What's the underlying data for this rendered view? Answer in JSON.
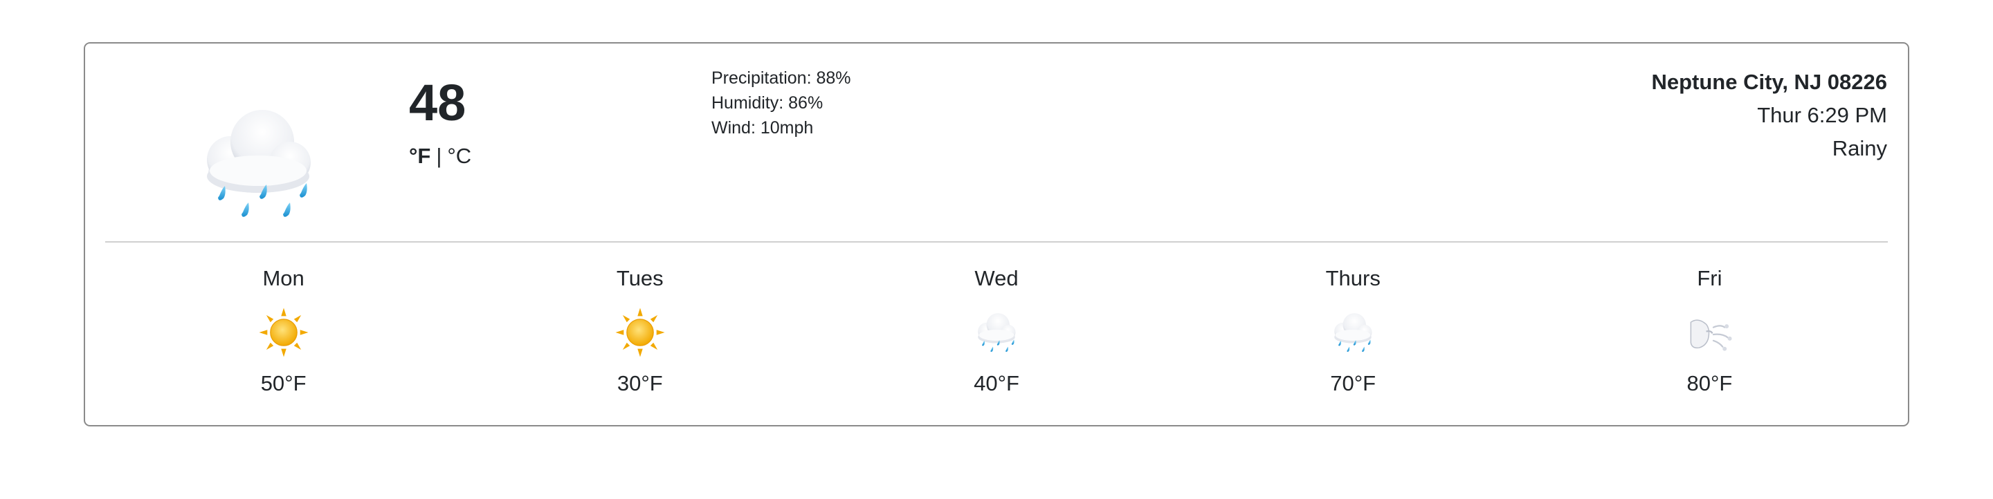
{
  "current": {
    "icon": "cloud-with-rain-icon",
    "temperature": "48",
    "unit_f": "°F",
    "unit_separator": "|",
    "unit_c": "°C",
    "precipitation": "Precipitation: 88%",
    "humidity": "Humidity: 86%",
    "wind": "Wind: 10mph"
  },
  "location": {
    "city": "Neptune City, NJ 08226",
    "datetime": "Thur 6:29 PM",
    "condition": "Rainy"
  },
  "forecast": [
    {
      "day": "Mon",
      "icon": "sun-icon",
      "temp": "50°F"
    },
    {
      "day": "Tues",
      "icon": "sun-icon",
      "temp": "30°F"
    },
    {
      "day": "Wed",
      "icon": "cloud-with-rain-icon",
      "temp": "40°F"
    },
    {
      "day": "Thurs",
      "icon": "cloud-with-rain-icon",
      "temp": "70°F"
    },
    {
      "day": "Fri",
      "icon": "wind-face-icon",
      "temp": "80°F"
    }
  ],
  "colors": {
    "border": "#8a8a8a",
    "divider": "#d0d0d0",
    "text": "#212529",
    "sun": "#f5b301",
    "rain": "#27a6e6"
  }
}
